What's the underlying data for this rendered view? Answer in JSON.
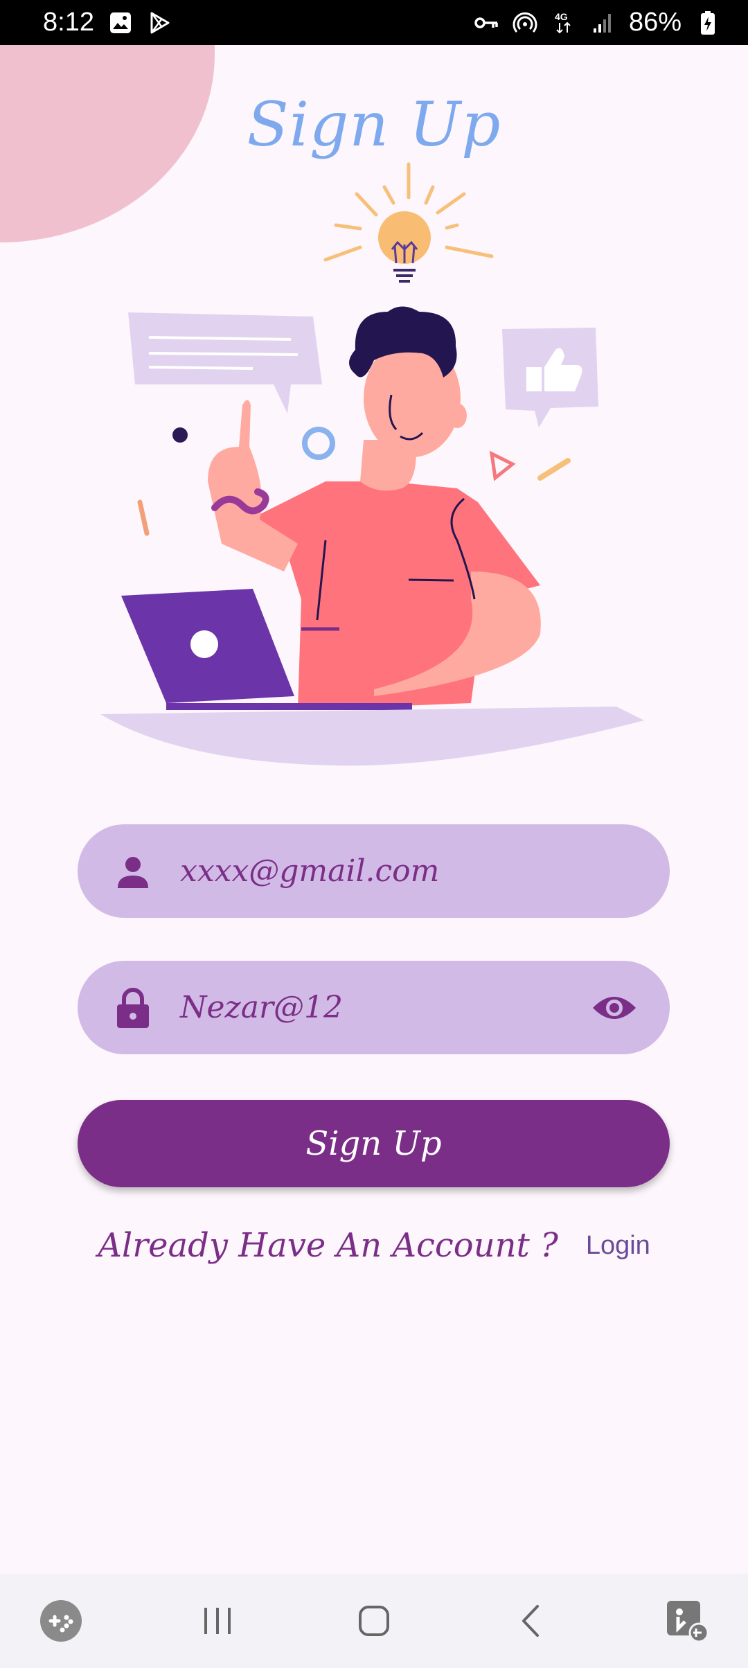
{
  "status_bar": {
    "time": "8:12",
    "battery": "86%",
    "left_icons": [
      "image-icon",
      "play-store-icon"
    ],
    "right_icons": [
      "vpn-key-icon",
      "hotspot-icon",
      "4g-icon",
      "signal-icon",
      "battery-charging-icon"
    ]
  },
  "page": {
    "title": "Sign Up"
  },
  "form": {
    "email_value": "xxxx@gmail.com",
    "password_value": "Nezar@12",
    "signup_label": "Sign Up"
  },
  "footer": {
    "already_text": "Already Have An Account ?",
    "login_label": "Login"
  },
  "colors": {
    "background": "#fdf6fc",
    "accent": "#7b2e87",
    "field": "#d1bae6",
    "title": "#7ea9ee"
  },
  "nav": {
    "icons": [
      "game-launcher-icon",
      "recents-icon",
      "home-icon",
      "back-icon",
      "accessibility-icon"
    ]
  }
}
